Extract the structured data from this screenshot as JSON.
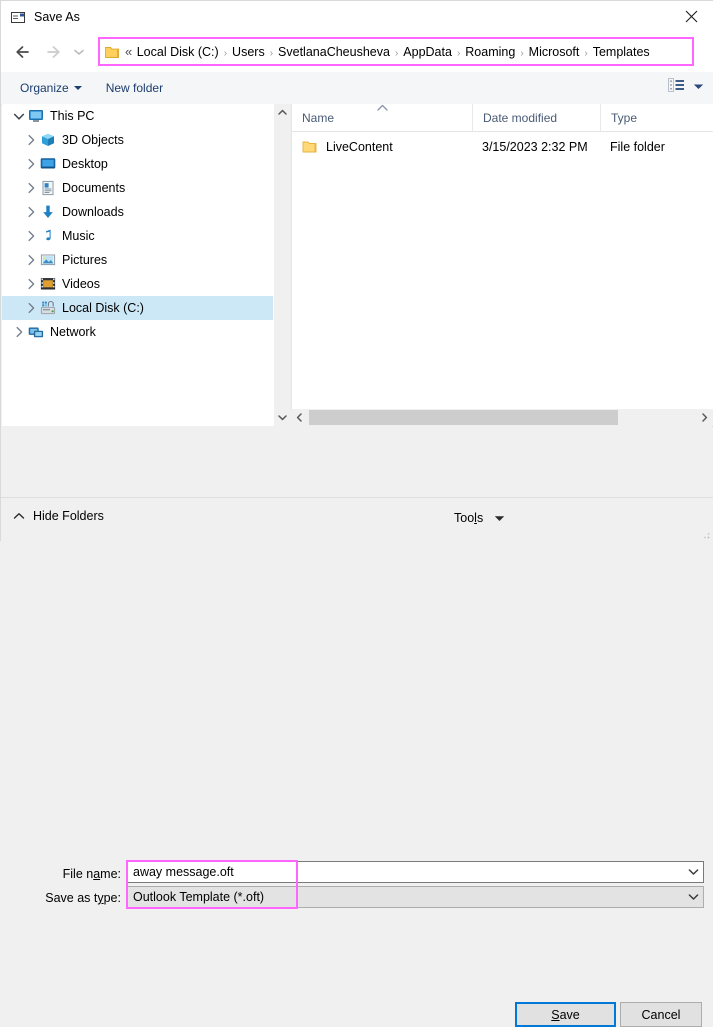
{
  "window": {
    "title": "Save As",
    "title_icon": "mail-window-icon",
    "close_label": "×"
  },
  "nav": {
    "back_icon": "arrow-left-icon",
    "forward_icon": "arrow-right-icon",
    "recent_icon": "chevron-down-icon",
    "folder_icon": "folder-icon",
    "crumb_prefix": "«",
    "separator": "›",
    "highlight_color": "#ff66ff",
    "breadcrumbs": [
      "Local Disk (C:)",
      "Users",
      "SvetlanaCheusheva",
      "AppData",
      "Roaming",
      "Microsoft",
      "Templates"
    ]
  },
  "commandbar": {
    "organize_label": "Organize",
    "new_folder_label": "New folder",
    "view_icon": "list-view-icon",
    "view_caret_icon": "chevron-down-icon"
  },
  "sidebar": {
    "items": [
      {
        "label": "This PC",
        "icon": "monitor-icon",
        "depth": 0,
        "expander": "chevron-down-icon",
        "selected": false
      },
      {
        "label": "3D Objects",
        "icon": "cube-icon",
        "depth": 1,
        "expander": "chevron-right-icon",
        "selected": false
      },
      {
        "label": "Desktop",
        "icon": "desktop-icon",
        "depth": 1,
        "expander": "chevron-right-icon",
        "selected": false
      },
      {
        "label": "Documents",
        "icon": "document-icon",
        "depth": 1,
        "expander": "chevron-right-icon",
        "selected": false
      },
      {
        "label": "Downloads",
        "icon": "download-icon",
        "depth": 1,
        "expander": "chevron-right-icon",
        "selected": false
      },
      {
        "label": "Music",
        "icon": "music-note-icon",
        "depth": 1,
        "expander": "chevron-right-icon",
        "selected": false
      },
      {
        "label": "Pictures",
        "icon": "picture-icon",
        "depth": 1,
        "expander": "chevron-right-icon",
        "selected": false
      },
      {
        "label": "Videos",
        "icon": "video-icon",
        "depth": 1,
        "expander": "chevron-right-icon",
        "selected": false
      },
      {
        "label": "Local Disk (C:)",
        "icon": "hard-drive-icon",
        "depth": 1,
        "expander": "chevron-right-icon",
        "selected": true
      },
      {
        "label": "Network",
        "icon": "network-icon",
        "depth": 0,
        "expander": "chevron-right-icon",
        "selected": false
      }
    ],
    "selection_color": "#cce8f7"
  },
  "filelist": {
    "columns": [
      "Name",
      "Date modified",
      "Type"
    ],
    "sort_column": "Name",
    "sort_direction": "ascending",
    "rows": [
      {
        "name": "LiveContent",
        "date_modified": "3/15/2023 2:32 PM",
        "type": "File folder",
        "icon": "folder-icon"
      }
    ]
  },
  "form": {
    "filename_label_pre": "File n",
    "filename_label_key": "a",
    "filename_label_post": "me:",
    "filename_value": "away message.oft",
    "savetype_label_pre": "Save as t",
    "savetype_label_key": "y",
    "savetype_label_post": "pe:",
    "savetype_value": "Outlook Template (*.oft)",
    "dropdown_icon": "chevron-down-icon",
    "highlight_color": "#ff66ff"
  },
  "footer": {
    "hide_folders_label": "Hide Folders",
    "hide_folders_icon": "chevron-up-icon",
    "tools_label_pre": "Too",
    "tools_label_key": "l",
    "tools_label_post": "s",
    "tools_caret_icon": "caret-down-icon",
    "save_label_pre": "",
    "save_label_key": "S",
    "save_label_post": "ave",
    "cancel_label": "Cancel",
    "focus_color": "#0078d7"
  }
}
